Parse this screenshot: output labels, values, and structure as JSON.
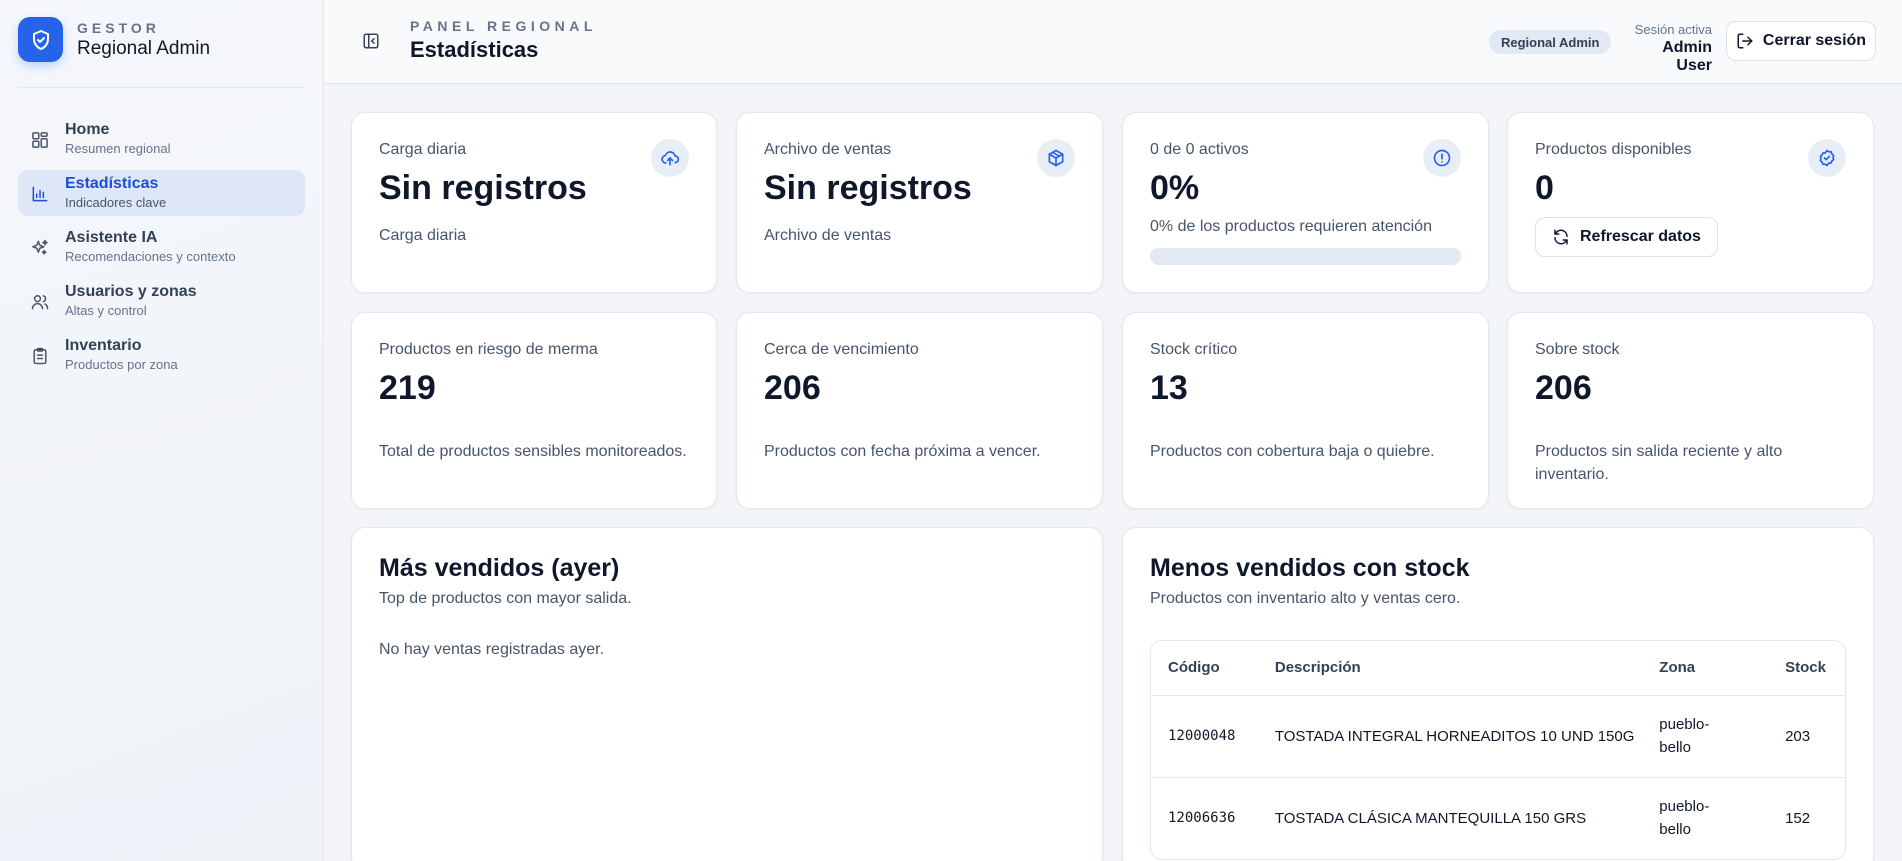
{
  "brand": {
    "eyebrow": "GESTOR",
    "title": "Regional Admin",
    "logo_icon": "shield-check-icon",
    "accent_color": "#2563eb"
  },
  "sidebar": {
    "items": [
      {
        "label": "Home",
        "sub": "Resumen regional",
        "icon": "dashboard-grid-icon",
        "active": false
      },
      {
        "label": "Estadísticas",
        "sub": "Indicadores clave",
        "icon": "bar-chart-icon",
        "active": true
      },
      {
        "label": "Asistente IA",
        "sub": "Recomendaciones y contexto",
        "icon": "sparkles-icon",
        "active": false
      },
      {
        "label": "Usuarios y zonas",
        "sub": "Altas y control",
        "icon": "users-icon",
        "active": false
      },
      {
        "label": "Inventario",
        "sub": "Productos por zona",
        "icon": "clipboard-list-icon",
        "active": false
      }
    ]
  },
  "header": {
    "eyebrow": "PANEL REGIONAL",
    "title": "Estadísticas",
    "role_badge": "Regional Admin",
    "session_label": "Sesión activa",
    "session_user": "Admin User",
    "logout_label": "Cerrar sesión"
  },
  "stats_top": [
    {
      "label": "Carga diaria",
      "value": "Sin registros",
      "sub": "Carga diaria",
      "icon": "cloud-upload-icon"
    },
    {
      "label": "Archivo de ventas",
      "value": "Sin registros",
      "sub": "Archivo de ventas",
      "icon": "package-icon"
    },
    {
      "label": "0 de 0 activos",
      "value": "0%",
      "sub": "0% de los productos requieren atención",
      "icon": "alert-circle-icon",
      "progress": 0
    },
    {
      "label": "Productos disponibles",
      "value": "0",
      "icon": "check-circle-icon",
      "button_label": "Refrescar datos",
      "button_icon": "refresh-icon"
    }
  ],
  "stats_bottom": [
    {
      "label": "Productos en riesgo de merma",
      "value": "219",
      "desc": "Total de productos sensibles monitoreados."
    },
    {
      "label": "Cerca de vencimiento",
      "value": "206",
      "desc": "Productos con fecha próxima a vencer."
    },
    {
      "label": "Stock crítico",
      "value": "13",
      "desc": "Productos con cobertura baja o quiebre."
    },
    {
      "label": "Sobre stock",
      "value": "206",
      "desc": "Productos sin salida reciente y alto inventario."
    }
  ],
  "best_sellers": {
    "title": "Más vendidos (ayer)",
    "subtitle": "Top de productos con mayor salida.",
    "empty": "No hay ventas registradas ayer."
  },
  "low_sellers": {
    "title": "Menos vendidos con stock",
    "subtitle": "Productos con inventario alto y ventas cero.",
    "columns": [
      "Código",
      "Descripción",
      "Zona",
      "Stock"
    ],
    "rows": [
      [
        "12000048",
        "TOSTADA INTEGRAL HORNEADITOS 10 UND 150G",
        "pueblo-bello",
        "203"
      ],
      [
        "12006636",
        "TOSTADA CLÁSICA MANTEQUILLA 150 GRS",
        "pueblo-bello",
        "152"
      ]
    ]
  }
}
